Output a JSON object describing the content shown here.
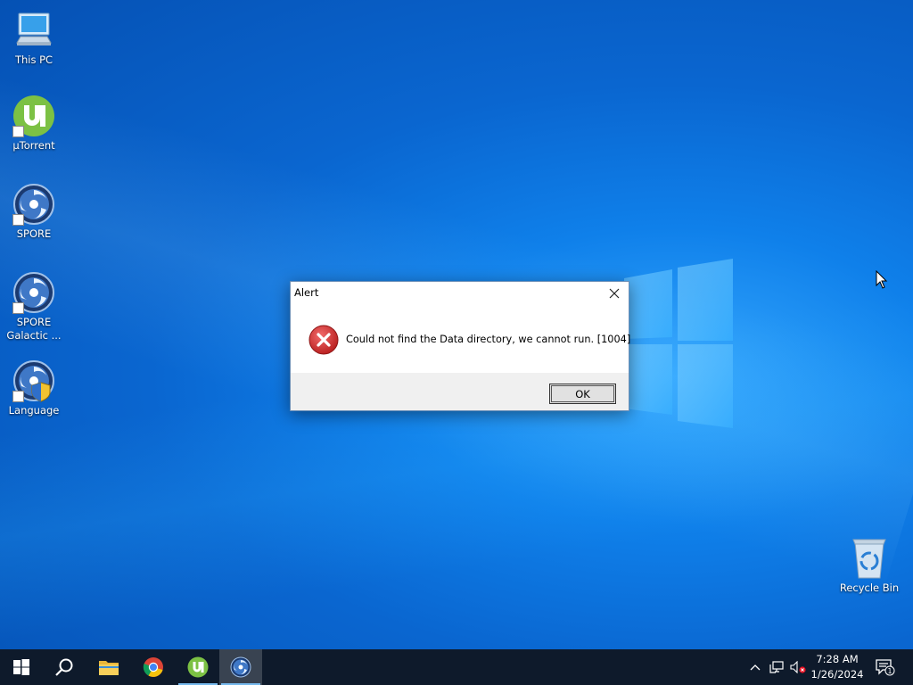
{
  "desktop": {
    "icons": [
      {
        "label": "This PC",
        "icon": "this-pc-icon"
      },
      {
        "label": "µTorrent",
        "icon": "utorrent-icon"
      },
      {
        "label": "SPORE",
        "icon": "spore-icon"
      },
      {
        "label": "SPORE Galactic ...",
        "icon": "spore-icon"
      },
      {
        "label": "Language",
        "icon": "spore-language-icon"
      },
      {
        "label": "Recycle Bin",
        "icon": "recycle-bin-icon"
      }
    ]
  },
  "dialog": {
    "title": "Alert",
    "message": "Could not find the Data directory, we cannot run. [1004]",
    "ok_label": "OK",
    "icon": "error-icon"
  },
  "taskbar": {
    "buttons": [
      {
        "name": "start",
        "icon": "windows-start-icon"
      },
      {
        "name": "search",
        "icon": "search-icon"
      },
      {
        "name": "file-explorer",
        "icon": "folder-icon"
      },
      {
        "name": "chrome",
        "icon": "chrome-icon"
      },
      {
        "name": "utorrent",
        "icon": "utorrent-icon",
        "running": true
      },
      {
        "name": "spore",
        "icon": "spore-icon",
        "running": true,
        "active": true
      }
    ],
    "tray": {
      "icons": [
        "chevron-up-icon",
        "network-icon",
        "volume-muted-icon"
      ],
      "time": "7:28 AM",
      "date": "1/26/2024",
      "notification_count": "1"
    }
  },
  "colors": {
    "accent": "#0078d7",
    "taskbar": "#0e1a2b",
    "error_red": "#c62828",
    "utorrent_green": "#7cc144"
  }
}
